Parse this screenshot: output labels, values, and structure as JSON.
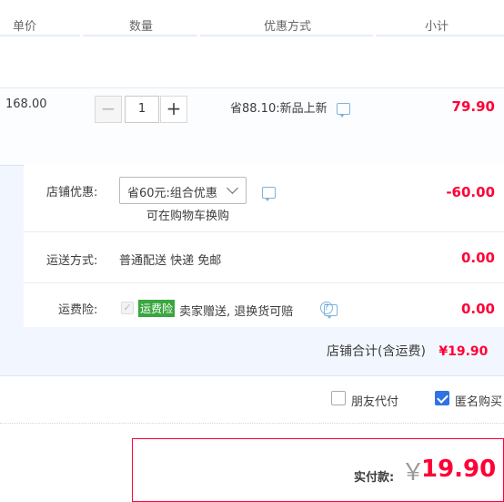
{
  "header": {
    "col_unit_price": "单价",
    "col_quantity": "数量",
    "col_discount": "优惠方式",
    "col_subtotal": "小计"
  },
  "item": {
    "unit_price": "168.00",
    "quantity": "1",
    "minus_label": "−",
    "plus_label": "+",
    "promo_text": "省88.10:新品上新",
    "subtotal": "79.90"
  },
  "shop": {
    "discount_label": "店铺优惠:",
    "discount_select": "省60元:组合优惠",
    "discount_note": "可在购物车换购",
    "discount_amount": "-60.00",
    "shipping_label": "运送方式:",
    "shipping_value": "普通配送 快递 免邮",
    "shipping_amount": "0.00",
    "insurance_label": "运费险:",
    "insurance_tag": "运费险",
    "insurance_text": "卖家赠送, 退换货可赔",
    "insurance_amount": "0.00",
    "insurance_check": "✓",
    "help_glyph": "?",
    "total_label": "店铺合计(含运费)",
    "total_value": "¥19.90"
  },
  "options": {
    "friend_pay": "朋友代付",
    "anonymous": "匿名购买",
    "friend_pay_checked": false,
    "anonymous_checked": true
  },
  "payment": {
    "label": "实付款:",
    "currency": "￥",
    "amount": "19.90"
  },
  "colors": {
    "price_red": "#ff0036",
    "accent_blue": "#3072e3",
    "tag_green": "#3aa640"
  }
}
